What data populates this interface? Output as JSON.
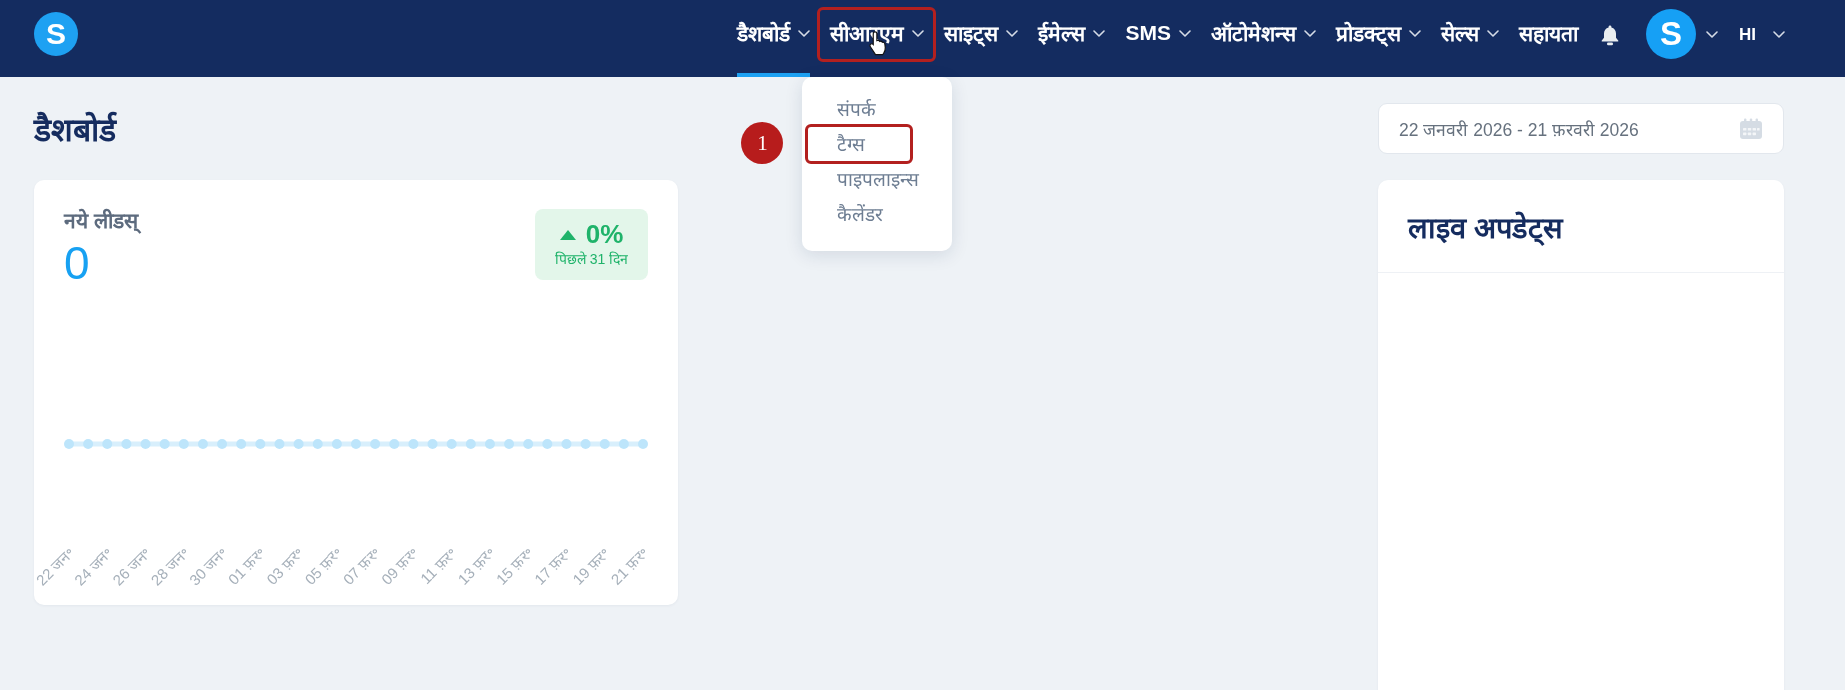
{
  "navbar": {
    "logo": "S",
    "items": [
      {
        "label": "डैशबोर्ड",
        "kind": "menu",
        "selected": true,
        "annotated": false,
        "hovered": false
      },
      {
        "label": "सीआरएम",
        "kind": "menu",
        "selected": false,
        "annotated": true,
        "hovered": true,
        "menu_items": [
          {
            "label": "संपर्क",
            "annotated": false
          },
          {
            "label": "टैग्स",
            "annotated": true,
            "step_number": "1"
          },
          {
            "label": "पाइपलाइन्स",
            "annotated": false
          },
          {
            "label": "कैलेंडर",
            "annotated": false
          }
        ]
      },
      {
        "label": "साइट्स",
        "kind": "menu",
        "selected": false,
        "annotated": false,
        "hovered": false
      },
      {
        "label": "ईमेल्स",
        "kind": "menu",
        "selected": false,
        "annotated": false,
        "hovered": false
      },
      {
        "label": "SMS",
        "kind": "menu",
        "selected": false,
        "annotated": false,
        "hovered": false
      },
      {
        "label": "ऑटोमेशन्स",
        "kind": "menu",
        "selected": false,
        "annotated": false,
        "hovered": false
      },
      {
        "label": "प्रोडक्ट्स",
        "kind": "menu",
        "selected": false,
        "annotated": false,
        "hovered": false
      },
      {
        "label": "सेल्स",
        "kind": "menu",
        "selected": false,
        "annotated": false,
        "hovered": false
      },
      {
        "label": "सहायता",
        "kind": "link",
        "selected": false,
        "annotated": false,
        "hovered": false
      }
    ],
    "avatar": "S",
    "language": "HI"
  },
  "page_title": "डैशबोर्ड",
  "leads_card": {
    "title": "नये लीडस्",
    "value": "0",
    "trend": {
      "increasing": true,
      "change": "0%",
      "period": "पिछले 31 दिन"
    },
    "x_labels": [
      "22 जन॰",
      "24 जन॰",
      "26 जन॰",
      "28 जन॰",
      "30 जन॰",
      "01 फ़र॰",
      "03 फ़र॰",
      "05 फ़र॰",
      "07 फ़र॰",
      "09 फ़र॰",
      "11 फ़र॰",
      "13 फ़र॰",
      "15 फ़र॰",
      "17 फ़र॰",
      "19 फ़र॰",
      "21 फ़र॰"
    ]
  },
  "date_range": {
    "value": "22 जनवरी 2026 - 21 फ़रवरी 2026"
  },
  "live_updates": {
    "title": "लाइव अपडेट्स"
  }
}
